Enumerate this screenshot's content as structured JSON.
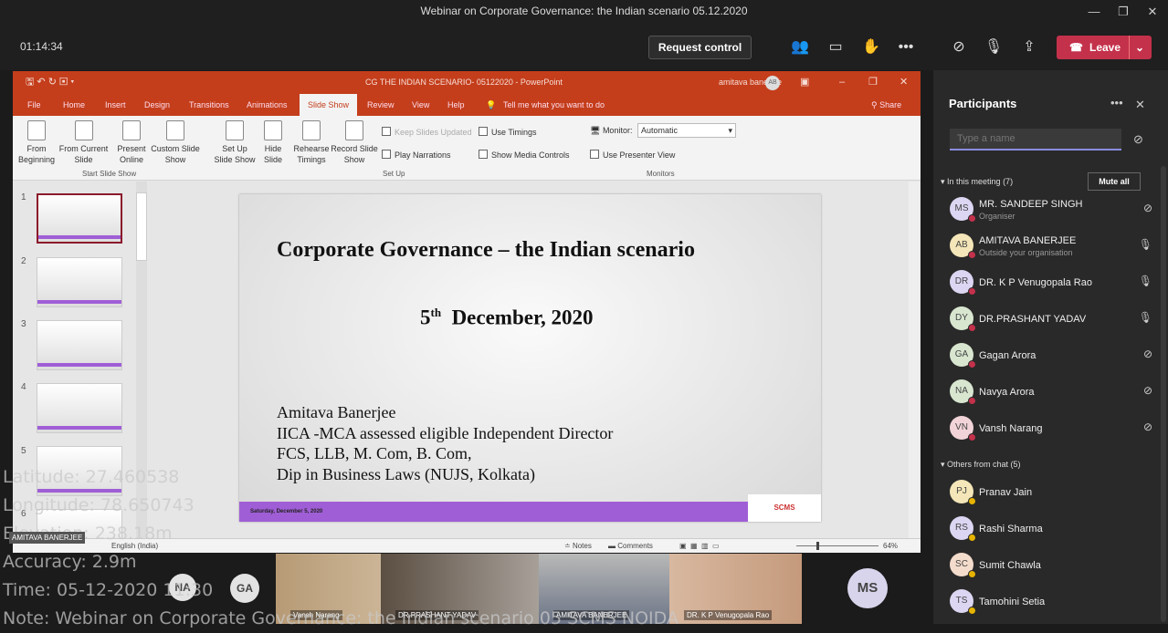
{
  "window": {
    "title": "Webinar on Corporate Governance: the Indian scenario 05.12.2020"
  },
  "toolbar": {
    "timer": "01:14:34",
    "request_control": "Request control",
    "leave": "Leave",
    "accent": "#c4314b"
  },
  "ppt": {
    "title": "CG THE INDIAN SCENARIO- 05122020  -  PowerPoint",
    "user": "amitava banerjee",
    "user_initials": "AB",
    "tabs": [
      "File",
      "Home",
      "Insert",
      "Design",
      "Transitions",
      "Animations",
      "Slide Show",
      "Review",
      "View",
      "Help"
    ],
    "tell_me": "Tell me what you want to do",
    "share": "Share",
    "ribbon": {
      "from_beginning": "From Beginning",
      "from_current": "From Current Slide",
      "present_online": "Present Online",
      "custom_show": "Custom Slide Show",
      "setup_show": "Set Up Slide Show",
      "hide_slide": "Hide Slide",
      "rehearse": "Rehearse Timings",
      "record": "Record Slide Show",
      "keep_updated": "Keep Slides Updated",
      "use_timings": "Use Timings",
      "play_narrations": "Play Narrations",
      "show_media": "Show Media Controls",
      "monitor_label": "Monitor:",
      "monitor_value": "Automatic",
      "presenter_view": "Use Presenter View",
      "group_start": "Start Slide Show",
      "group_setup": "Set Up",
      "group_monitors": "Monitors"
    },
    "thumbnails": [
      "1",
      "2",
      "3",
      "4",
      "5",
      "6"
    ],
    "slide": {
      "title": "Corporate Governance – the Indian scenario",
      "date_day": "5",
      "date_sup": "th",
      "date_rest": "December, 2020",
      "lines": [
        "Amitava Banerjee",
        "IICA -MCA  assessed eligible Independent Director",
        "FCS, LLB, M. Com, B. Com,",
        "Dip in Business Laws (NUJS, Kolkata)"
      ],
      "footer_date": "Saturday, December 5, 2020",
      "logo": "SCMS"
    },
    "status": {
      "language": "English (India)",
      "notes": "Notes",
      "comments": "Comments",
      "zoom": "64%",
      "zoom_value": 64
    }
  },
  "presenter_label": "AMITAVA BANERJEE",
  "overlay": [
    "Latitude: 27.460538",
    "Longitude: 78.650743",
    "Elevation: 238.18m",
    "Accuracy: 2.9m",
    "Time: 05-12-2020 11:30",
    "Note: Webinar on Corporate Governance: the Indian scenario 05 SCMS NOIDA"
  ],
  "videos": [
    {
      "label": "Vansh Narang"
    },
    {
      "label": "DR.PRASHANT YADAV"
    },
    {
      "label": "AMITAVA BANERJEE"
    },
    {
      "label": "DR. K P Venugopala Rao"
    }
  ],
  "stage_avatars": [
    "NA",
    "GA",
    "MS"
  ],
  "participants": {
    "title": "Participants",
    "search_placeholder": "Type a name",
    "in_meeting": "In this meeting (7)",
    "mute_all": "Mute all",
    "members": [
      {
        "initials": "MS",
        "name": "MR. SANDEEP SINGH",
        "sub": "Organiser",
        "mic": "muted"
      },
      {
        "initials": "AB",
        "name": "AMITAVA BANERJEE",
        "sub": "Outside your organisation",
        "mic": "on"
      },
      {
        "initials": "DR",
        "name": "DR. K P Venugopala Rao",
        "sub": "",
        "mic": "on"
      },
      {
        "initials": "DY",
        "name": "DR.PRASHANT YADAV",
        "sub": "",
        "mic": "on"
      },
      {
        "initials": "GA",
        "name": "Gagan Arora",
        "sub": "",
        "mic": "muted"
      },
      {
        "initials": "NA",
        "name": "Navya Arora",
        "sub": "",
        "mic": "muted"
      },
      {
        "initials": "VN",
        "name": "Vansh Narang",
        "sub": "",
        "mic": "muted"
      }
    ],
    "others": "Others from chat (5)",
    "chat": [
      {
        "initials": "PJ",
        "name": "Pranav Jain"
      },
      {
        "initials": "RS",
        "name": "Rashi Sharma"
      },
      {
        "initials": "SC",
        "name": "Sumit Chawla"
      },
      {
        "initials": "TS",
        "name": "Tamohini Setia"
      }
    ]
  }
}
